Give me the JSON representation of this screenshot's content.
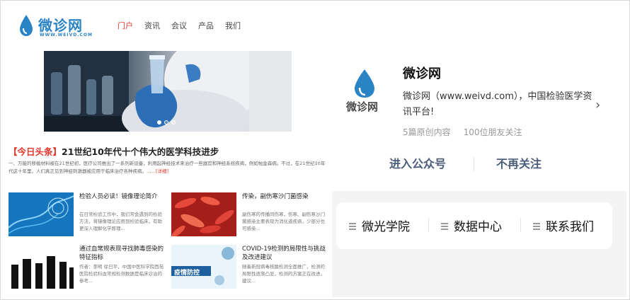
{
  "left": {
    "logo": {
      "text": "微诊网",
      "sub": "WWW.WEIVD.COM"
    },
    "nav": [
      "门户",
      "资讯",
      "会议",
      "产品",
      "我们"
    ],
    "nav_active": 0,
    "headline": {
      "tag": "【今日头条】",
      "title": "21世纪10年代十个伟大的医学科技进步"
    },
    "summary": {
      "text": "一、万能的移植材料被在21世纪初，医疗公司推出了一系列新设备，利用起神经技术来治疗一些器官和神经系统疾病，例如帕金森病。不过，在21世纪10年代这十年里，人们真正见到神经刺激器被应用于临床治疗各种疾病。",
      "more": "……[详细]"
    },
    "news": [
      {
        "title": "检验人员必读！镜像理论简介",
        "desc": "在日常检验工作中，我们常会遇到的检验方法，将镜像理论应用到检验临床，有助更深入理解化学原理..."
      },
      {
        "title": "传染，副伤寒沙门菌感染",
        "desc": "副伤寒的传播同伤寒，伤寒、副伤寒沙门菌感染主要表现为消化道疾病，少部分也可感染..."
      },
      {
        "title": "通过血常规表现寻找肺毒感染的特征指标",
        "desc": "作者：李明 徐日平，中国中医科学院西苑医院检验科血常规检测数据是临床诊治的参考..."
      },
      {
        "title": "COVID-19检测的局限性与挑战及改进建议",
        "desc": "随着新冠病毒核酸检测全面推广，检测的局限性逐渐凸显，检测的方案正在改进，建议..."
      }
    ],
    "hero_badge": "疫情防控"
  },
  "right": {
    "account_name": "微诊网",
    "account_desc": "微诊网（www.weivd.com），中国检验医学资讯平台!",
    "stats": [
      "5篇原创内容",
      "100位朋友关注"
    ],
    "buttons": {
      "enter": "进入公众号",
      "unfollow": "不再关注"
    },
    "menu": [
      "微光学院",
      "数据中心",
      "联系我们"
    ],
    "logo_text": "微诊网"
  },
  "colors": {
    "accent_red": "#e2372d",
    "brand_blue": "#2a83c4",
    "button_blue": "#4a5d7a"
  }
}
